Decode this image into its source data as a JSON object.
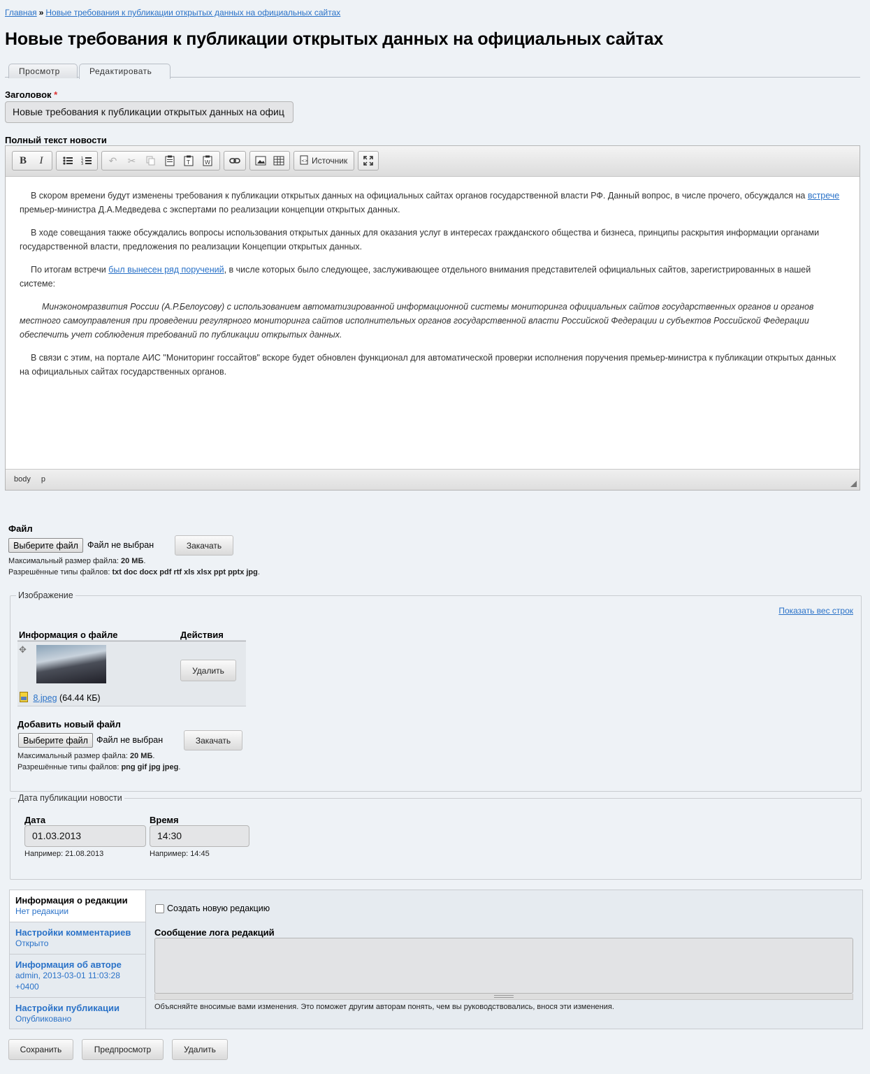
{
  "breadcrumb": {
    "home": "Главная",
    "separator": "»",
    "current": "Новые требования к публикации открытых данных на официальных сайтах"
  },
  "page": {
    "title": "Новые требования к публикации открытых данных на официальных сайтах"
  },
  "tabs": [
    {
      "label": "Просмотр",
      "active": false
    },
    {
      "label": "Редактировать",
      "active": true
    }
  ],
  "title_field": {
    "label": "Заголовок",
    "required_mark": "*",
    "value": "Новые требования к публикации открытых данных на офиц"
  },
  "body_field": {
    "label": "Полный текст новости"
  },
  "editor": {
    "toolbar": {
      "bold": "B",
      "italic": "I",
      "icons": [
        "bulleted-list",
        "numbered-list",
        "undo",
        "cut",
        "copy",
        "paste",
        "paste-text",
        "paste-word",
        "link",
        "image",
        "table",
        "source",
        "maximize"
      ],
      "source_label": "Источник"
    },
    "content": {
      "p1_pre": "В скором времени будут изменены требования к публикации открытых данных на официальных сайтах органов государственной власти РФ. Данный вопрос, в числе прочего, обсуждался на ",
      "p1_link": "встрече",
      "p1_post": " премьер-министра Д.А.Медведева с экспертами по реализации концепции открытых данных.",
      "p2": "В ходе совещания также обсуждались вопросы использования открытых данных для оказания услуг в интересах гражданского общества и бизнеса, принципы раскрытия информации органами государственной власти, предложения по реализации Концепции открытых данных.",
      "p3_pre": "По итогам встречи ",
      "p3_link": "был вынесен ряд поручений",
      "p3_post": ", в числе которых было следующее, заслуживающее отдельного внимания представителей официальных сайтов, зарегистрированных в нашей системе:",
      "quote": "Минэкономразвития России (А.Р.Белоусову) с использованием автоматизированной информационной системы мониторинга официальных сайтов государственных органов и органов местного самоуправления при проведении регулярного мониторинга сайтов      исполнительных органов государственной власти Российской Федерации и субъектов Российской Федерации обеспечить учет соблюдения требований по публикации открытых данных.",
      "p4": "В связи с этим, на портале АИС \"Мониторинг госсайтов\" вскоре будет обновлен функционал для автоматической проверки исполнения поручения премьер-министра к публикации открытых данных на официальных сайтах государственных органов."
    },
    "status_path": [
      "body",
      "p"
    ]
  },
  "file_field": {
    "label": "Файл",
    "choose_button": "Выберите файл",
    "no_file": "Файл не выбран",
    "upload_button": "Закачать",
    "max_size_label": "Максимальный размер файла:",
    "max_size_value": "20 МБ",
    "types_label": "Разрешённые типы файлов:",
    "types_value": "txt doc docx pdf rtf xls xlsx ppt pptx jpg"
  },
  "image_field": {
    "legend": "Изображение",
    "show_weights": "Показать вес строк",
    "col_info": "Информация о файле",
    "col_actions": "Действия",
    "file_name": "8.jpeg",
    "file_size": "(64.44 КБ)",
    "delete_button": "Удалить",
    "add_new_label": "Добавить новый файл",
    "choose_button": "Выберите файл",
    "no_file": "Файл не выбран",
    "upload_button": "Закачать",
    "max_size_label": "Максимальный размер файла:",
    "max_size_value": "20 МБ",
    "types_label": "Разрешённые типы файлов:",
    "types_value": "png gif jpg jpeg"
  },
  "date_field": {
    "legend": "Дата публикации новости",
    "date_label": "Дата",
    "date_value": "01.03.2013",
    "date_hint": "Например: 21.08.2013",
    "time_label": "Время",
    "time_value": "14:30",
    "time_hint": "Например: 14:45"
  },
  "vertical_tabs": [
    {
      "title": "Информация о редакции",
      "summary": "Нет редакции",
      "active": true
    },
    {
      "title": "Настройки комментариев",
      "summary": "Открыто",
      "active": false
    },
    {
      "title": "Информация об авторе",
      "summary": "admin, 2013-03-01 11:03:28 +0400",
      "active": false
    },
    {
      "title": "Настройки публикации",
      "summary": "Опубликовано",
      "active": false
    }
  ],
  "revision": {
    "checkbox_label": "Создать новую редакцию",
    "log_label": "Сообщение лога редакций",
    "log_value": "",
    "hint": "Объясняйте вносимые вами изменения. Это поможет другим авторам понять, чем вы руководствовались, внося эти изменения."
  },
  "actions": {
    "save": "Сохранить",
    "preview": "Предпросмотр",
    "delete": "Удалить"
  }
}
